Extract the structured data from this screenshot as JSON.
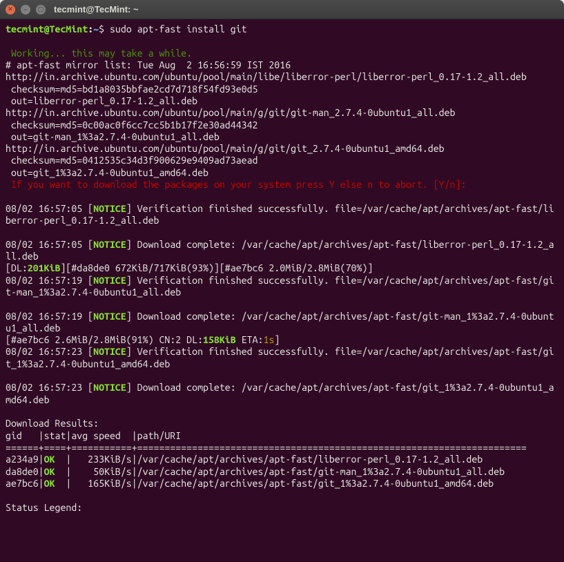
{
  "window": {
    "title": "tecmint@TecMint: ~"
  },
  "prompt": {
    "user_host": "tecmint@TecMint",
    "colon": ":",
    "path": "~",
    "symbol": "$ ",
    "command": "sudo apt-fast install git"
  },
  "lines": {
    "working": " Working... this may take a while.",
    "mirror": "# apt-fast mirror list: Tue Aug  2 16:56:59 IST 2016",
    "u1": "http://in.archive.ubuntu.com/ubuntu/pool/main/libe/liberror-perl/liberror-perl_0.17-1.2_all.deb",
    "c1": " checksum=md5=bd1a8035bbfae2cd7d718f54fd93e0d5",
    "o1": " out=liberror-perl_0.17-1.2_all.deb",
    "u2": "http://in.archive.ubuntu.com/ubuntu/pool/main/g/git/git-man_2.7.4-0ubuntu1_all.deb",
    "c2": " checksum=md5=0c00ac0f6cc7cc5b1b17f2e30ad44342",
    "o2": " out=git-man_1%3a2.7.4-0ubuntu1_all.deb",
    "u3": "http://in.archive.ubuntu.com/ubuntu/pool/main/g/git/git_2.7.4-0ubuntu1_amd64.deb",
    "c3": " checksum=md5=0412535c34d3f900629e9409ad73aead",
    "o3": " out=git_1%3a2.7.4-0ubuntu1_amd64.deb",
    "confirm": " If you want to download the packages on your system press Y else n to abort. [Y/n]:",
    "ts1": "08/02 16:57:05 [",
    "notice": "NOTICE",
    "ver1": "] Verification finished successfully. file=/var/cache/apt/archives/apt-fast/liberror-perl_0.17-1.2_all.deb",
    "ts2": "08/02 16:57:05 [",
    "dl1": "] Download complete: /var/cache/apt/archives/apt-fast/liberror-perl_0.17-1.2_all.deb",
    "dlp1": "[DL:",
    "dlsize": "201KiB",
    "dlp2": "][#da8de0 672KiB/717KiB(93%)][#ae7bc6 2.0MiB/2.8MiB(70%)]",
    "ts3": "08/02 16:57:19 [",
    "ver2": "] Verification finished successfully. file=/var/cache/apt/archives/apt-fast/git-man_1%3a2.7.4-0ubuntu1_all.deb",
    "ts4": "08/02 16:57:19 [",
    "dl2": "] Download complete: /var/cache/apt/archives/apt-fast/git-man_1%3a2.7.4-0ubuntu1_all.deb",
    "prog1": "[#ae7bc6 2.6MiB/2.8MiB(91%) CN:2 DL:",
    "dlrate": "158KiB",
    "prog2": " ETA:",
    "eta": "1s",
    "prog3": "]",
    "ts5": "08/02 16:57:23 [",
    "ver3": "] Verification finished successfully. file=/var/cache/apt/archives/apt-fast/git_1%3a2.7.4-0ubuntu1_amd64.deb",
    "ts6": "08/02 16:57:23 [",
    "dl3": "] Download complete: /var/cache/apt/archives/apt-fast/git_1%3a2.7.4-0ubuntu1_amd64.deb",
    "res_hdr": "Download Results:",
    "res_cols": "gid   |stat|avg speed  |path/URI",
    "res_sep": "======+====+===========+=======================================================================",
    "rgid1": "a234a9|",
    "ok": "OK",
    "r1rest": "  |   233KiB/s|/var/cache/apt/archives/apt-fast/liberror-perl_0.17-1.2_all.deb",
    "rgid2": "da8de0|",
    "r2rest": "  |    50KiB/s|/var/cache/apt/archives/apt-fast/git-man_1%3a2.7.4-0ubuntu1_all.deb",
    "rgid3": "ae7bc6|",
    "r3rest": "  |   165KiB/s|/var/cache/apt/archives/apt-fast/git_1%3a2.7.4-0ubuntu1_amd64.deb",
    "status": "Status Legend:"
  }
}
